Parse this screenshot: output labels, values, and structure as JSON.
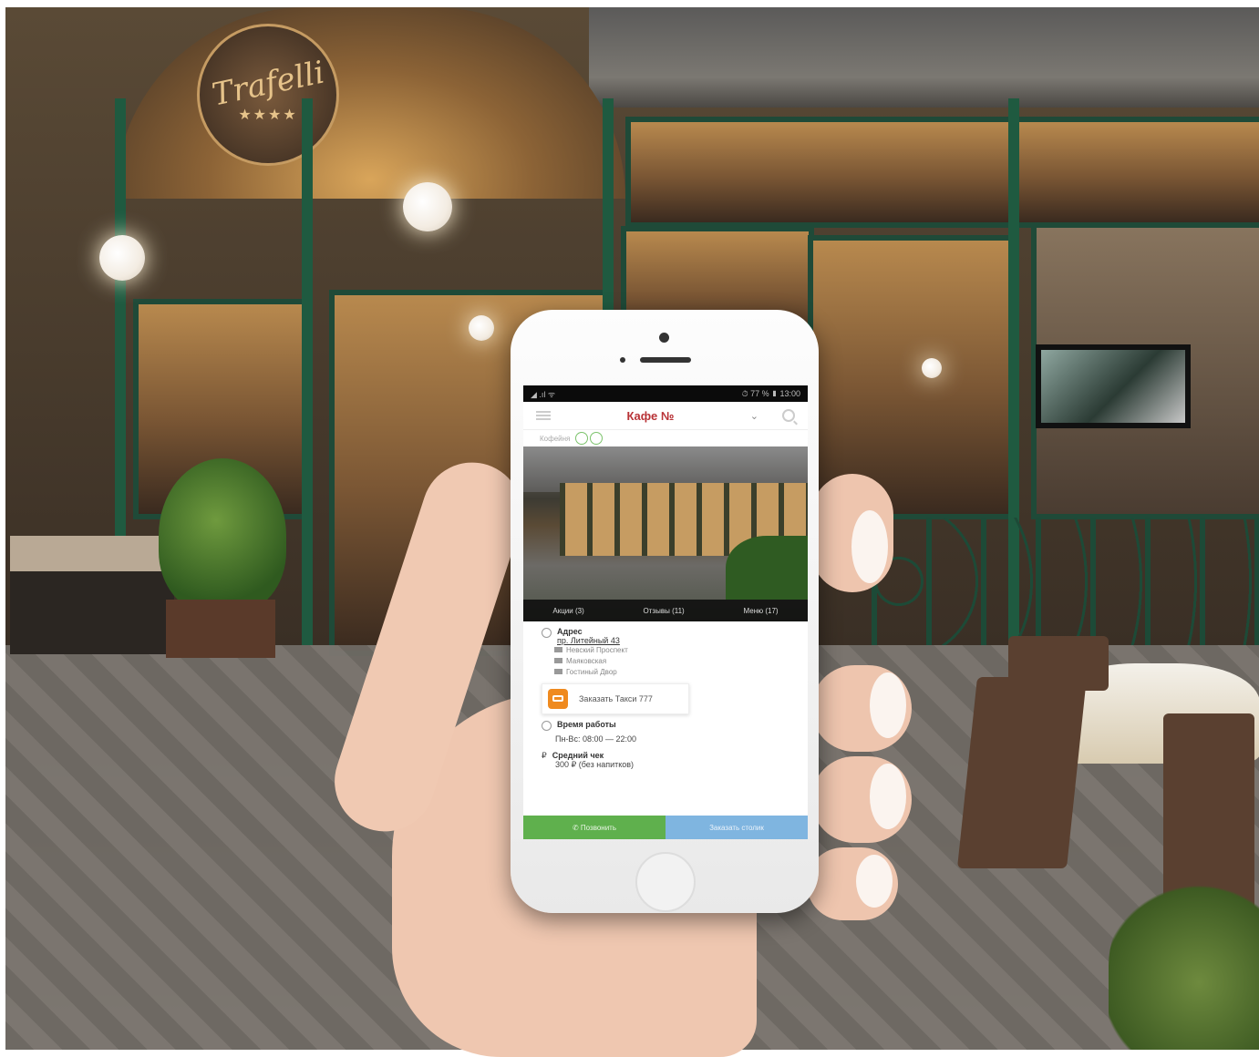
{
  "sign": {
    "name": "Trafelli",
    "stars": "★★★★"
  },
  "status_bar": {
    "left": "◢ .ıl ᯤ",
    "right": "⏱ 77 % ▮ 13:00"
  },
  "app_bar": {
    "title": "Кафе №",
    "chevron": "⌄"
  },
  "subrow": {
    "label": "Кофейня"
  },
  "tabs": [
    {
      "label": "Акции (3)"
    },
    {
      "label": "Отзывы (11)"
    },
    {
      "label": "Меню (17)"
    }
  ],
  "address": {
    "label": "Адрес",
    "street": "пр. Литейный 43",
    "metro": [
      "Невский Проспект",
      "Маяковская",
      "Гостиный Двор"
    ]
  },
  "taxi": {
    "label": "Заказать Такси 777"
  },
  "hours": {
    "label": "Время работы",
    "value": "Пн-Вс: 08:00 — 22:00"
  },
  "avg_check": {
    "label": "Средний чек",
    "value": "300 ₽ (без напитков)"
  },
  "actions": {
    "call": "✆ Позвонить",
    "book": "Заказать столик"
  },
  "colors": {
    "title": "#b83236",
    "call": "#5fb04d",
    "book": "#7fb5e0",
    "taxi": "#ef8a1f"
  }
}
